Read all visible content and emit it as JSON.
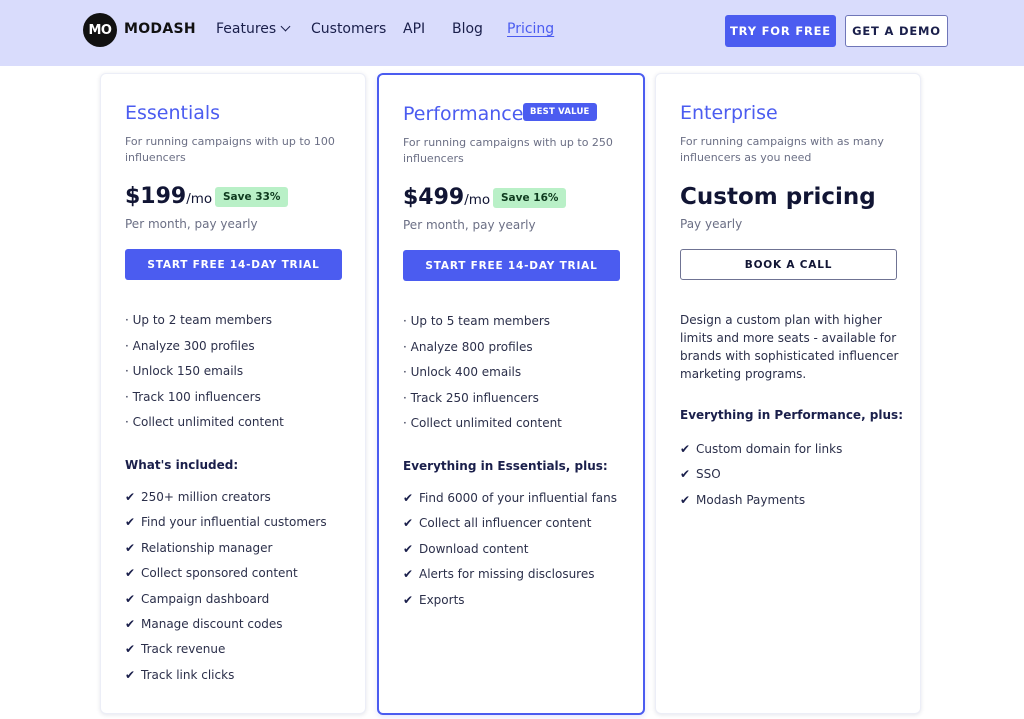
{
  "header": {
    "logo_text": "MO",
    "brand": "MODASH",
    "nav": [
      "Features",
      "Customers",
      "API",
      "Blog",
      "Pricing"
    ],
    "try_label": "TRY FOR FREE",
    "demo_label": "GET A DEMO"
  },
  "colors": {
    "accent": "#4b5cf0",
    "header_bg": "#d9dcfc",
    "save_badge": "#b9f0c7"
  },
  "plans": [
    {
      "title": "Essentials",
      "description": "For running campaigns with up to 100 influencers",
      "price": "$199",
      "per": "/mo",
      "save": "Save 33%",
      "billing": "Per month, pay yearly",
      "cta": "START FREE 14-DAY TRIAL",
      "limits": [
        "· Up to 2 team members",
        "· Analyze 300 profiles",
        "· Unlock 150 emails",
        "· Track 100 influencers",
        "· Collect unlimited content"
      ],
      "features_title": "What's included:",
      "features": [
        "250+ million creators",
        "Find your influential customers",
        "Relationship manager",
        "Collect sponsored content",
        "Campaign dashboard",
        "Manage discount codes",
        "Track revenue",
        "Track link clicks"
      ]
    },
    {
      "title": "Performance",
      "badge": "BEST VALUE",
      "description": "For running campaigns with up to 250 influencers",
      "price": "$499",
      "per": "/mo",
      "save": "Save 16%",
      "billing": "Per month, pay yearly",
      "cta": "START FREE 14-DAY TRIAL",
      "limits": [
        "· Up to 5 team members",
        "· Analyze 800 profiles",
        "· Unlock 400 emails",
        "· Track 250 influencers",
        "· Collect unlimited content"
      ],
      "features_title": "Everything in Essentials, plus:",
      "features": [
        "Find 6000 of your influential fans",
        "Collect all influencer content",
        "Download content",
        "Alerts for missing disclosures",
        "Exports"
      ]
    },
    {
      "title": "Enterprise",
      "description": "For running campaigns with as many influencers as you need",
      "price": "Custom pricing",
      "billing": "Pay yearly",
      "cta": "BOOK A CALL",
      "body": "Design a custom plan with higher limits and more seats - available for brands with sophisticated influencer marketing programs.",
      "features_title": "Everything in Performance, plus:",
      "features": [
        "Custom domain for links",
        "SSO",
        "Modash Payments"
      ]
    }
  ]
}
